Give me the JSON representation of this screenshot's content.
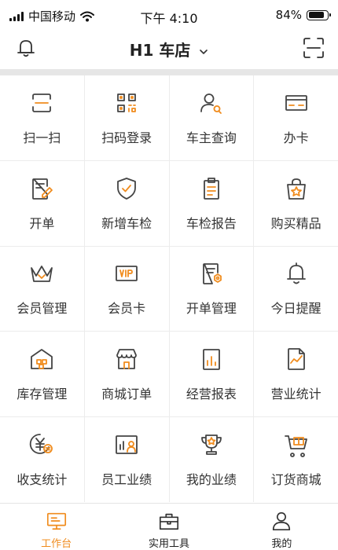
{
  "status_bar": {
    "carrier": "中国移动",
    "time": "下午 4:10",
    "battery": "84%",
    "battery_level": 0.84
  },
  "header": {
    "store_name": "H1 车店"
  },
  "colors": {
    "accent": "#f08c1e",
    "icon": "#444444"
  },
  "grid": [
    {
      "label": "扫一扫",
      "icon": "scan-icon"
    },
    {
      "label": "扫码登录",
      "icon": "qr-code-icon"
    },
    {
      "label": "车主查询",
      "icon": "user-search-icon"
    },
    {
      "label": "办卡",
      "icon": "card-icon"
    },
    {
      "label": "开单",
      "icon": "edit-document-icon"
    },
    {
      "label": "新增车检",
      "icon": "shield-check-icon"
    },
    {
      "label": "车检报告",
      "icon": "clipboard-icon"
    },
    {
      "label": "购买精品",
      "icon": "shopping-bag-icon"
    },
    {
      "label": "会员管理",
      "icon": "crown-icon"
    },
    {
      "label": "会员卡",
      "icon": "vip-card-icon"
    },
    {
      "label": "开单管理",
      "icon": "order-settings-icon"
    },
    {
      "label": "今日提醒",
      "icon": "bell-icon"
    },
    {
      "label": "库存管理",
      "icon": "warehouse-icon"
    },
    {
      "label": "商城订单",
      "icon": "shop-order-icon"
    },
    {
      "label": "经营报表",
      "icon": "report-icon"
    },
    {
      "label": "营业统计",
      "icon": "trend-document-icon"
    },
    {
      "label": "收支统计",
      "icon": "income-expense-icon"
    },
    {
      "label": "员工业绩",
      "icon": "staff-performance-icon"
    },
    {
      "label": "我的业绩",
      "icon": "trophy-icon"
    },
    {
      "label": "订货商城",
      "icon": "cart-icon"
    }
  ],
  "tabbar": [
    {
      "label": "工作台",
      "icon": "monitor-icon",
      "active": true
    },
    {
      "label": "实用工具",
      "icon": "toolbox-icon",
      "active": false
    },
    {
      "label": "我的",
      "icon": "profile-icon",
      "active": false
    }
  ]
}
